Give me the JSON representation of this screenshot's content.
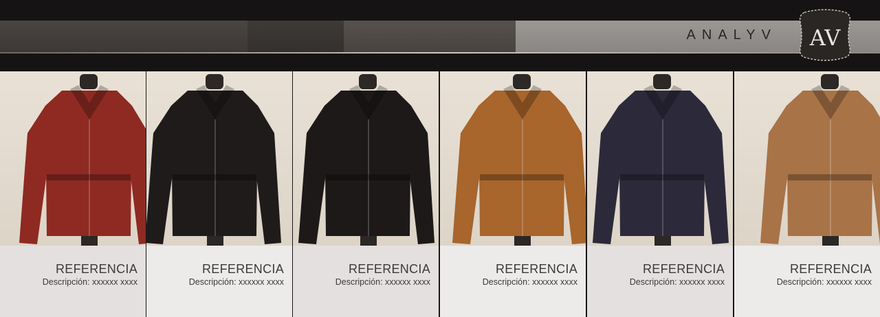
{
  "brand": {
    "name": "ANALYV",
    "logo_text": "AV"
  },
  "products": [
    {
      "reference": "REFERENCIA",
      "description": "Descripción: xxxxxx xxxx",
      "color": "#8e2a22"
    },
    {
      "reference": "REFERENCIA",
      "description": "Descripción: xxxxxx xxxx",
      "color": "#1f1b1a"
    },
    {
      "reference": "REFERENCIA",
      "description": "Descripción: xxxxxx xxxx",
      "color": "#1c1918"
    },
    {
      "reference": "REFERENCIA",
      "description": "Descripción: xxxxxx xxxx",
      "color": "#a8652c"
    },
    {
      "reference": "REFERENCIA",
      "description": "Descripción: xxxxxx xxxx",
      "color": "#2c2a3a"
    },
    {
      "reference": "REFERENCIA",
      "description": "Descripción: xxxxxx xxxx",
      "color": "#a87347"
    }
  ]
}
